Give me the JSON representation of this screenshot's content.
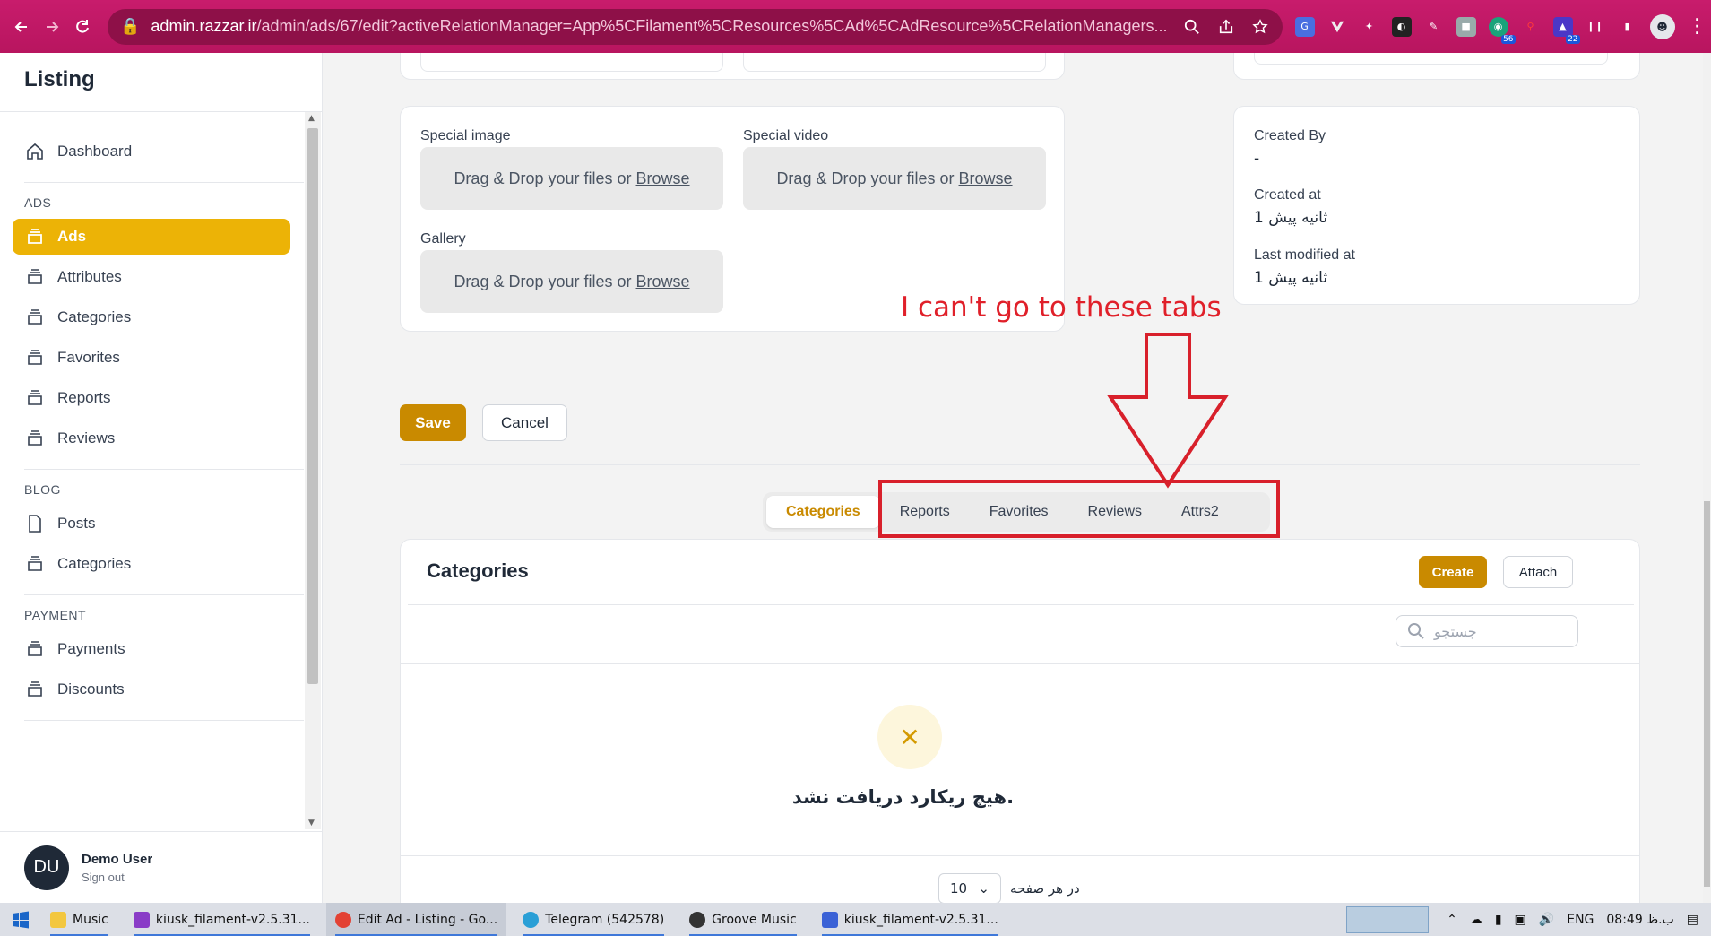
{
  "browser": {
    "url_host": "admin.razzar.ir",
    "url_rest": "/admin/ads/67/edit?activeRelationManager=App%5CFilament%5CResources%5CAd%5CAdResource%5CRelationManagers..."
  },
  "sidebar": {
    "brand": "Listing",
    "dashboard": "Dashboard",
    "groups": [
      {
        "label": "ADS",
        "items": [
          "Ads",
          "Attributes",
          "Categories",
          "Favorites",
          "Reports",
          "Reviews"
        ]
      },
      {
        "label": "BLOG",
        "items": [
          "Posts",
          "Categories"
        ]
      },
      {
        "label": "PAYMENT",
        "items": [
          "Payments",
          "Discounts"
        ]
      }
    ],
    "user": {
      "initials": "DU",
      "name": "Demo User",
      "signout": "Sign out"
    }
  },
  "form": {
    "special_image_label": "Special image",
    "special_video_label": "Special video",
    "gallery_label": "Gallery",
    "dropzone_text": "Drag & Drop your files or",
    "dropzone_browse": "Browse",
    "created_by_label": "Created By",
    "created_by_value": "-",
    "created_at_label": "Created at",
    "created_at_value": "1 ثانیه پیش",
    "modified_label": "Last modified at",
    "modified_value": "1 ثانیه پیش",
    "save": "Save",
    "cancel": "Cancel"
  },
  "annotation": {
    "text": "I can't go to these tabs"
  },
  "tabs": [
    "Categories",
    "Reports",
    "Favorites",
    "Reviews",
    "Attrs2"
  ],
  "relation": {
    "title": "Categories",
    "create": "Create",
    "attach": "Attach",
    "search_placeholder": "جستجو",
    "empty_text": "هیچ ریکارد دریافت نشد.",
    "per_page_value": "10",
    "per_page_label": "در هر صفحه"
  },
  "taskbar": {
    "tasks": [
      "Music",
      "kiusk_filament-v2.5.31...",
      "Edit Ad - Listing - Go...",
      "Telegram (542578)",
      "Groove Music",
      "kiusk_filament-v2.5.31..."
    ],
    "lang": "ENG",
    "time": "08:49 ب.ظ"
  },
  "colors": {
    "accent": "#c98a00",
    "active_nav": "#ecb306",
    "annotation": "#d8202b",
    "browser": "#c81c6c"
  }
}
